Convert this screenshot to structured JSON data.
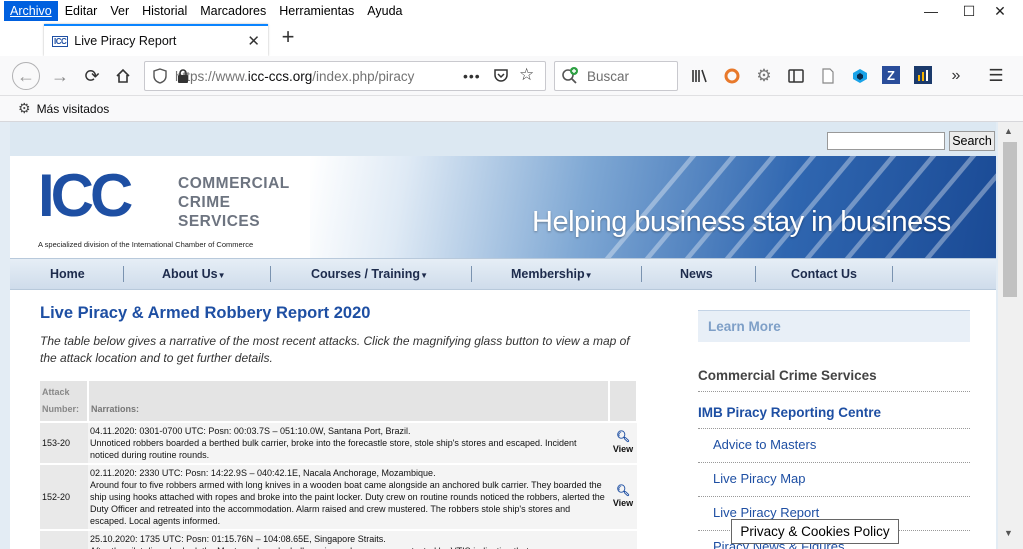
{
  "menu": [
    "Archivo",
    "Editar",
    "Ver",
    "Historial",
    "Marcadores",
    "Herramientas",
    "Ayuda"
  ],
  "tab": {
    "title": "Live Piracy Report",
    "favicon": "ICC"
  },
  "urlbar": {
    "host_prefix": "https://www.",
    "host": "icc-ccs.org",
    "path": "/index.php/piracy"
  },
  "searchbar": {
    "placeholder": "Buscar"
  },
  "bookmarks": {
    "label": "Más visitados"
  },
  "site": {
    "search_button": "Search",
    "logo": {
      "letters": "ICC",
      "line1": "COMMERCIAL",
      "line2": "CRIME",
      "line3": "SERVICES",
      "subtitle": "A specialized division of the International Chamber of Commerce"
    },
    "tagline": "Helping business stay in business",
    "nav": [
      "Home",
      "About Us",
      "Courses / Training",
      "Membership",
      "News",
      "Contact Us"
    ],
    "title": "Live Piracy & Armed Robbery Report 2020",
    "intro": "The table below gives a narrative of the most recent attacks. Click the magnifying glass button to view a map of the attack location and to get further details.",
    "table": {
      "headers": {
        "number": "Attack Number:",
        "narration": "Narrations:"
      },
      "rows": [
        {
          "number": "153-20",
          "narration": "04.11.2020: 0301-0700 UTC: Posn: 00:03.7S – 051:10.0W, Santana Port, Brazil.\nUnnoticed robbers boarded a berthed bulk carrier, broke into the forecastle store, stole ship's stores and escaped. Incident noticed during routine rounds.",
          "view": "View"
        },
        {
          "number": "152-20",
          "narration": "02.11.2020: 2330 UTC: Posn: 14:22.9S – 040:42.1E, Nacala Anchorage, Mozambique.\nAround four to five robbers armed with long knives in a wooden boat came alongside an anchored bulk carrier. They boarded the ship using hooks attached with ropes and broke into the paint locker. Duty crew on routine rounds noticed the robbers, alerted the Duty Officer and retreated into the accommodation. Alarm raised and crew mustered. The robbers stole ship's stores and escaped. Local agents informed.",
          "view": "View"
        },
        {
          "number": "",
          "narration": "25.10.2020: 1735 UTC: Posn: 01:15.76N – 104:08.65E, Singapore Straits.\nAfter the pilot disembarked, the Master onboard a bulk carrier underway was contacted by VTIS indicating that",
          "view": ""
        }
      ]
    },
    "sidebar": {
      "learn_more": "Learn More",
      "ccs": "Commercial Crime Services",
      "imb": "IMB Piracy Reporting Centre",
      "links": [
        "Advice to Masters",
        "Live Piracy Map",
        "Live Piracy Report",
        "Piracy News & Figures"
      ]
    },
    "cookie": "Privacy & Cookies Policy"
  }
}
